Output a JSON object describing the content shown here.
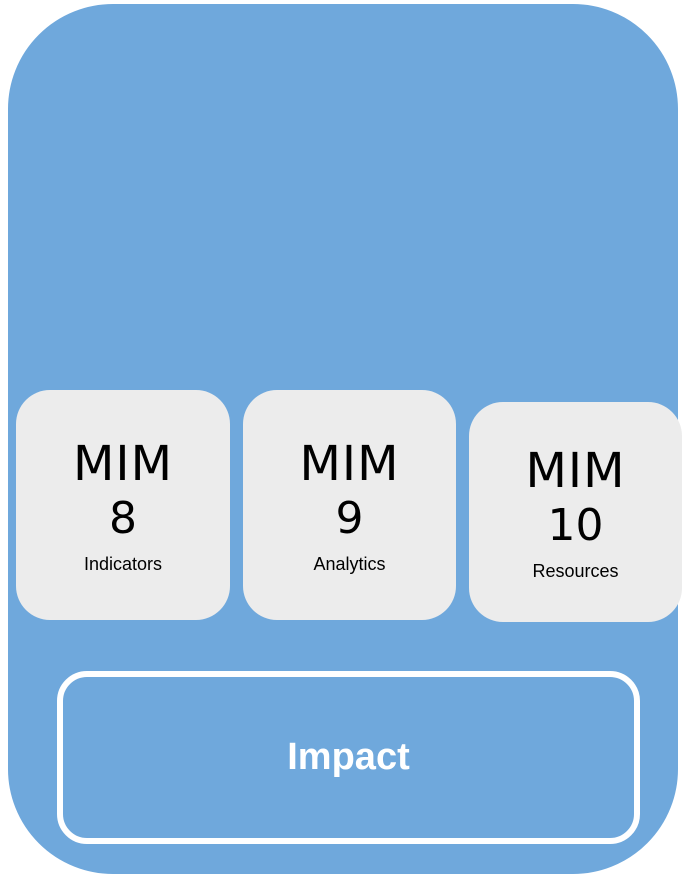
{
  "cards": [
    {
      "title": "MIM",
      "number": "8",
      "label": "Indicators"
    },
    {
      "title": "MIM",
      "number": "9",
      "label": "Analytics"
    },
    {
      "title": "MIM",
      "number": "10",
      "label": "Resources"
    }
  ],
  "impact": {
    "label": "Impact"
  },
  "colors": {
    "panel": "#6fa8dc",
    "card": "#ececec",
    "outline": "#ffffff"
  }
}
